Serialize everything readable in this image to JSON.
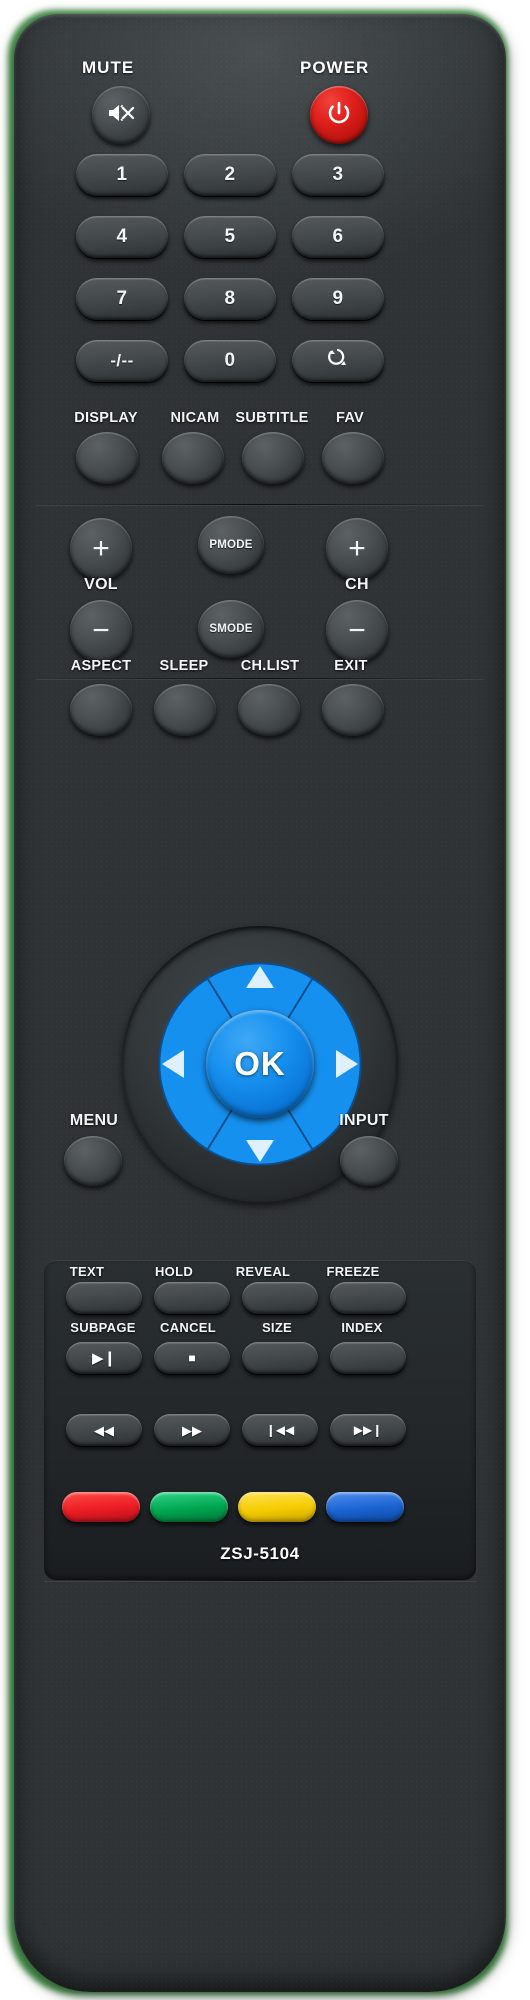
{
  "device": {
    "kind": "tv-remote-control",
    "model": "ZSJ-5104",
    "body_color": "#2e3336",
    "accent_blue": "#1690ef",
    "power_red": "#d9201c"
  },
  "top_row": {
    "mute_label": "MUTE",
    "mute_icon": "mute-speaker-icon",
    "power_label": "POWER",
    "power_icon": "power-icon"
  },
  "keypad": {
    "rows": [
      [
        "1",
        "2",
        "3"
      ],
      [
        "4",
        "5",
        "6"
      ],
      [
        "7",
        "8",
        "9"
      ],
      [
        "-/--",
        "0",
        "↺"
      ]
    ],
    "recall_icon": "recall-return-icon"
  },
  "function_row": {
    "labels": [
      "DISPLAY",
      "NICAM",
      "SUBTITLE",
      "FAV"
    ]
  },
  "volume_channel": {
    "vol_label": "VOL",
    "ch_label": "CH",
    "vol_up": "+",
    "vol_down": "−",
    "ch_up": "+",
    "ch_down": "−",
    "picture_mode": "PMODE",
    "sound_mode": "SMODE"
  },
  "mode_row": {
    "labels": [
      "ASPECT",
      "SLEEP",
      "CH.LIST",
      "EXIT"
    ]
  },
  "navigation": {
    "ok_label": "OK",
    "up_icon": "arrow-up-icon",
    "down_icon": "arrow-down-icon",
    "left_icon": "arrow-left-icon",
    "right_icon": "arrow-right-icon",
    "menu_label": "MENU",
    "input_label": "INPUT"
  },
  "teletext": {
    "row1_labels": [
      "TEXT",
      "HOLD",
      "REVEAL",
      "FREEZE"
    ],
    "row2_labels": [
      "SUBPAGE",
      "CANCEL",
      "SIZE",
      "INDEX"
    ]
  },
  "media": {
    "row1": [
      {
        "icon": "play-pause-icon",
        "glyph": "▶❙"
      },
      {
        "icon": "stop-icon",
        "glyph": "■"
      },
      {
        "icon": "blank-icon",
        "glyph": ""
      },
      {
        "icon": "blank-icon",
        "glyph": ""
      }
    ],
    "row2": [
      {
        "icon": "rewind-icon",
        "glyph": "◀◀"
      },
      {
        "icon": "fast-forward-icon",
        "glyph": "▶▶"
      },
      {
        "icon": "previous-track-icon",
        "glyph": "❙◀◀"
      },
      {
        "icon": "next-track-icon",
        "glyph": "▶▶❙"
      }
    ]
  },
  "color_keys": [
    {
      "name": "red-key",
      "color": "#ec1c24"
    },
    {
      "name": "green-key",
      "color": "#00a550"
    },
    {
      "name": "yellow-key",
      "color": "#f5cb00"
    },
    {
      "name": "blue-key",
      "color": "#1a63d0"
    }
  ]
}
